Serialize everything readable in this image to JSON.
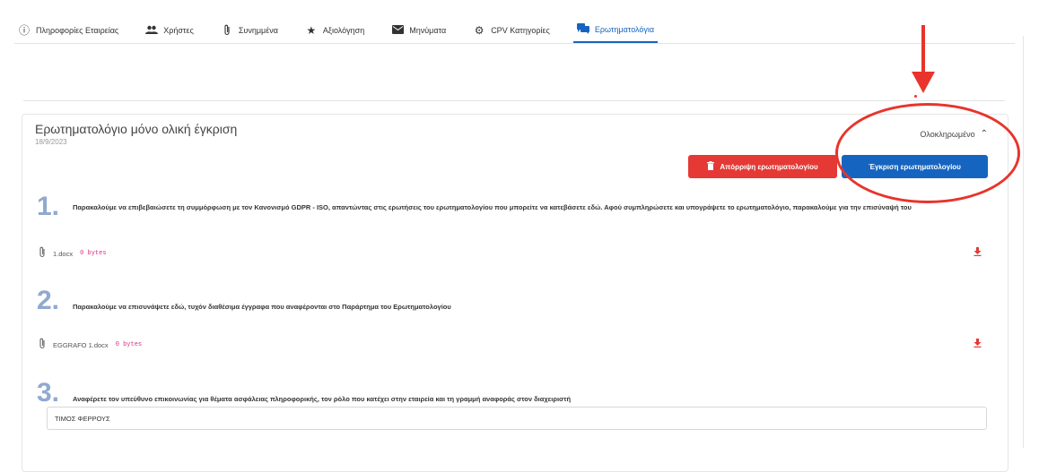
{
  "tabs": [
    {
      "label": "Πληροφορίες Εταιρείας",
      "icon": "info-icon"
    },
    {
      "label": "Χρήστες",
      "icon": "people-icon"
    },
    {
      "label": "Συνημμένα",
      "icon": "paperclip-icon"
    },
    {
      "label": "Αξιολόγηση",
      "icon": "star-icon"
    },
    {
      "label": "Μηνύματα",
      "icon": "envelope-icon"
    },
    {
      "label": "CPV Κατηγορίες",
      "icon": "gear-icon"
    },
    {
      "label": "Ερωτηματολόγια",
      "icon": "chat-icon",
      "active": true
    }
  ],
  "questionnaire": {
    "title": "Ερωτηματολόγιο μόνο ολική έγκριση",
    "date": "18/9/2023",
    "status": "Ολοκληρωμένο",
    "reject_label": "Απόρριψη ερωτηματολογίου",
    "approve_label": "Έγκριση ερωτηματολογίου"
  },
  "questions": [
    {
      "number": "1.",
      "text": "Παρακαλούμε να επιβεβαιώσετε τη συμμόρφωση με τον Κανονισμό GDPR - ISO, απαντώντας στις ερωτήσεις του ερωτηματολογίου που μπορείτε να κατεβάσετε εδώ. Αφού συμπληρώσετε και υπογράψετε το ερωτηματολόγιο, παρακαλούμε για την επισύναψή του",
      "file_name": "1.docx",
      "file_size": "0 bytes"
    },
    {
      "number": "2.",
      "text": "Παρακαλούμε να επισυνάψετε εδώ, τυχόν διαθέσιμα έγγραφα που αναφέρονται στο Παράρτημα του Ερωτηματολογίου",
      "file_name": "EGGRAFO 1.docx",
      "file_size": "0 bytes"
    },
    {
      "number": "3.",
      "text": "Αναφέρετε τον υπεύθυνο επικοινωνίας για θέματα ασφάλειας πληροφορικής, τον ρόλο που κατέχει στην εταιρεία και τη γραμμή αναφοράς στον διαχειριστή",
      "answer": "ΤΙΜΟΣ ΦΕΡΡΟΥΣ"
    }
  ],
  "colors": {
    "accent": "#1565c0",
    "danger": "#e53935",
    "annotation": "#e8342c",
    "number": "#90a9cf"
  }
}
